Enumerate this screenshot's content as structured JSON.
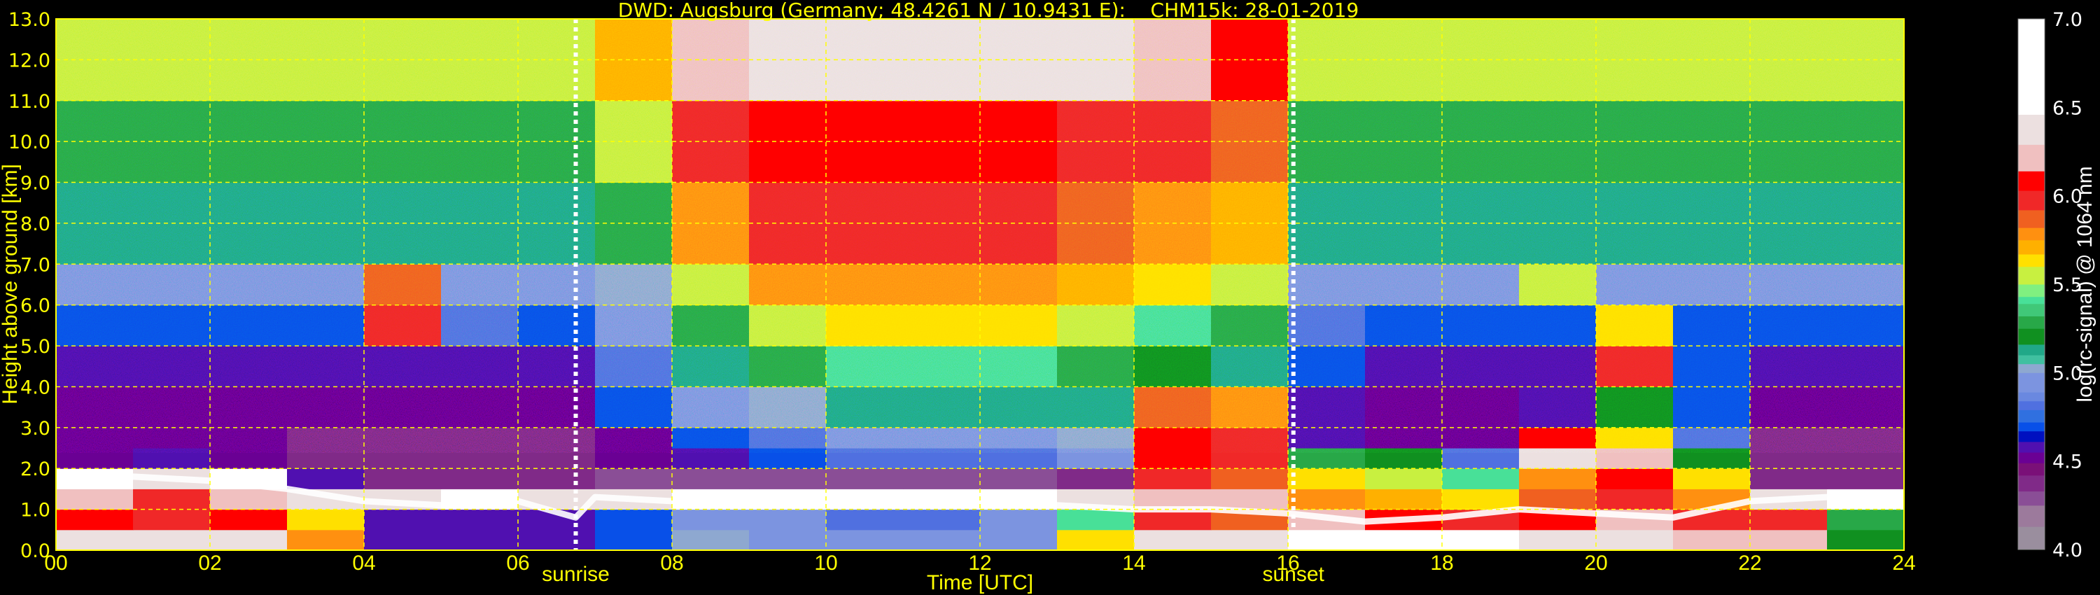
{
  "chart_data": {
    "type": "heatmap",
    "title": "DWD: Augsburg (Germany; 48.4261 N / 10.9431 E):    CHM15k: 28-01-2019",
    "xlabel": "Time [UTC]",
    "ylabel": "Height above ground [km]",
    "colorbar_label": "log(rc-signal) @ 1064 nm",
    "xlim": [
      0,
      24
    ],
    "ylim": [
      0,
      13
    ],
    "clim": [
      4.0,
      7.0
    ],
    "grid": true,
    "x_ticks": [
      "00",
      "02",
      "04",
      "06",
      "08",
      "10",
      "12",
      "14",
      "16",
      "18",
      "20",
      "22",
      "24"
    ],
    "y_ticks": [
      "0.0",
      "1.0",
      "2.0",
      "3.0",
      "4.0",
      "5.0",
      "6.0",
      "7.0",
      "8.0",
      "9.0",
      "10.0",
      "11.0",
      "12.0",
      "13.0"
    ],
    "colorbar_ticks": [
      "4.0",
      "4.5",
      "5.0",
      "5.5",
      "6.0",
      "6.5",
      "7.0"
    ],
    "annotations": [
      {
        "label": "sunrise",
        "time_h": 6.75
      },
      {
        "label": "sunset",
        "time_h": 16.07
      }
    ],
    "time_bins_h": [
      0,
      1,
      2,
      3,
      4,
      5,
      6,
      7,
      8,
      9,
      10,
      11,
      12,
      13,
      14,
      15,
      16,
      17,
      18,
      19,
      20,
      21,
      22,
      23,
      24
    ],
    "height_bins_km": [
      0,
      0.5,
      1,
      1.5,
      2,
      2.5,
      3,
      4,
      5,
      6,
      7,
      9,
      11,
      13
    ],
    "values": [
      [
        6.4,
        6.3,
        6.3,
        5.8,
        4.6,
        4.6,
        4.6,
        4.7,
        5.0,
        4.9,
        4.9,
        4.9,
        4.9,
        5.6,
        6.4,
        6.3,
        6.7,
        6.7,
        6.6,
        6.3,
        6.4,
        6.2,
        6.2,
        5.2
      ],
      [
        6.1,
        6.0,
        6.1,
        5.6,
        4.6,
        4.6,
        4.6,
        4.7,
        4.9,
        4.9,
        4.8,
        4.8,
        4.9,
        5.4,
        6.0,
        5.9,
        6.2,
        6.1,
        6.0,
        6.1,
        6.2,
        6.0,
        6.0,
        5.3
      ],
      [
        6.2,
        6.0,
        6.2,
        6.3,
        6.4,
        6.5,
        6.4,
        6.4,
        6.5,
        6.5,
        6.6,
        6.6,
        6.6,
        6.4,
        6.2,
        6.2,
        5.8,
        5.7,
        5.6,
        5.9,
        6.0,
        5.8,
        6.3,
        6.6
      ],
      [
        6.5,
        6.4,
        6.5,
        4.6,
        4.4,
        4.4,
        4.4,
        4.3,
        4.3,
        4.3,
        4.3,
        4.3,
        4.3,
        4.4,
        6.0,
        5.9,
        5.6,
        5.5,
        5.4,
        5.8,
        6.1,
        5.6,
        4.4,
        4.4
      ],
      [
        4.5,
        4.6,
        4.5,
        4.4,
        4.4,
        4.4,
        4.4,
        4.5,
        4.6,
        4.7,
        4.8,
        4.8,
        4.8,
        4.9,
        6.1,
        6.0,
        5.3,
        5.2,
        4.8,
        6.3,
        6.2,
        5.2,
        4.4,
        4.4
      ],
      [
        4.5,
        4.5,
        4.5,
        4.4,
        4.4,
        4.4,
        4.4,
        4.5,
        4.7,
        4.8,
        4.9,
        4.9,
        4.9,
        5.0,
        6.1,
        6.0,
        4.6,
        4.5,
        4.5,
        6.1,
        5.6,
        4.8,
        4.4,
        4.4
      ],
      [
        4.5,
        4.5,
        4.5,
        4.5,
        4.5,
        4.5,
        4.5,
        4.7,
        4.9,
        5.0,
        5.1,
        5.1,
        5.1,
        5.1,
        5.9,
        5.8,
        4.6,
        4.5,
        4.5,
        4.6,
        5.2,
        4.7,
        4.5,
        4.5
      ],
      [
        4.6,
        4.6,
        4.6,
        4.6,
        4.6,
        4.6,
        4.6,
        4.8,
        5.1,
        5.3,
        5.4,
        5.4,
        5.4,
        5.3,
        5.2,
        5.1,
        4.7,
        4.6,
        4.6,
        4.6,
        6.0,
        4.7,
        4.6,
        4.6
      ],
      [
        4.7,
        4.7,
        4.7,
        4.7,
        6.0,
        4.8,
        4.7,
        4.9,
        5.3,
        5.5,
        5.6,
        5.6,
        5.6,
        5.5,
        5.4,
        5.3,
        4.8,
        4.7,
        4.7,
        4.7,
        5.6,
        4.7,
        4.7,
        4.7
      ],
      [
        4.9,
        4.9,
        4.9,
        4.9,
        5.9,
        4.9,
        4.9,
        5.0,
        5.5,
        5.8,
        5.8,
        5.8,
        5.8,
        5.7,
        5.6,
        5.5,
        4.9,
        4.9,
        4.9,
        5.5,
        4.9,
        4.9,
        4.9,
        4.9
      ],
      [
        5.1,
        5.1,
        5.1,
        5.1,
        5.1,
        5.1,
        5.1,
        5.3,
        5.8,
        6.0,
        6.0,
        6.0,
        6.0,
        5.9,
        5.8,
        5.7,
        5.1,
        5.1,
        5.1,
        5.1,
        5.1,
        5.1,
        5.1,
        5.1
      ],
      [
        5.3,
        5.3,
        5.3,
        5.3,
        5.3,
        5.3,
        5.3,
        5.5,
        6.0,
        6.1,
        6.1,
        6.1,
        6.1,
        6.0,
        6.0,
        5.9,
        5.3,
        5.3,
        5.3,
        5.3,
        5.3,
        5.3,
        5.3,
        5.3
      ],
      [
        5.5,
        5.5,
        5.5,
        5.5,
        5.5,
        5.5,
        5.5,
        5.7,
        6.2,
        6.3,
        6.4,
        6.4,
        6.4,
        6.3,
        6.2,
        6.1,
        5.5,
        5.5,
        5.5,
        5.5,
        5.5,
        5.5,
        5.5,
        5.5
      ]
    ],
    "boundary_layer_top": {
      "time_h": [
        0,
        1,
        2,
        3,
        4,
        5,
        6,
        6.75,
        7,
        8,
        9,
        10,
        11,
        12,
        13,
        14,
        15,
        16,
        17,
        18,
        19,
        20,
        21,
        22,
        23,
        24
      ],
      "height_km": [
        1.7,
        1.8,
        1.7,
        1.5,
        1.2,
        1.1,
        1.2,
        0.8,
        1.3,
        1.2,
        1.2,
        1.1,
        1.2,
        1.2,
        1.1,
        1.0,
        1.0,
        0.9,
        0.7,
        0.8,
        1.0,
        0.9,
        0.8,
        1.2,
        1.3,
        1.4
      ]
    },
    "colormap": [
      {
        "min": 4.0,
        "color": "#9a8e9e"
      },
      {
        "min": 4.13,
        "color": "#9c7a9c"
      },
      {
        "min": 4.25,
        "color": "#8a4e96"
      },
      {
        "min": 4.33,
        "color": "#802a88"
      },
      {
        "min": 4.42,
        "color": "#7a1078"
      },
      {
        "min": 4.49,
        "color": "#6a0094"
      },
      {
        "min": 4.55,
        "color": "#5010b0"
      },
      {
        "min": 4.61,
        "color": "#0010c0"
      },
      {
        "min": 4.67,
        "color": "#0850e8"
      },
      {
        "min": 4.72,
        "color": "#3070e0"
      },
      {
        "min": 4.79,
        "color": "#5070e0"
      },
      {
        "min": 4.84,
        "color": "#6a88e0"
      },
      {
        "min": 4.89,
        "color": "#7c94e0"
      },
      {
        "min": 5.0,
        "color": "#8ea8d0"
      },
      {
        "min": 5.05,
        "color": "#40c0a0"
      },
      {
        "min": 5.1,
        "color": "#20a888"
      },
      {
        "min": 5.16,
        "color": "#109020"
      },
      {
        "min": 5.25,
        "color": "#28a848"
      },
      {
        "min": 5.32,
        "color": "#40c878"
      },
      {
        "min": 5.39,
        "color": "#48e098"
      },
      {
        "min": 5.43,
        "color": "#80f080"
      },
      {
        "min": 5.5,
        "color": "#c8f040"
      },
      {
        "min": 5.6,
        "color": "#ffe000"
      },
      {
        "min": 5.67,
        "color": "#ffb000"
      },
      {
        "min": 5.75,
        "color": "#ff9010"
      },
      {
        "min": 5.82,
        "color": "#f06020"
      },
      {
        "min": 5.92,
        "color": "#f02828"
      },
      {
        "min": 6.03,
        "color": "#ff0000"
      },
      {
        "min": 6.14,
        "color": "#f0c0c0"
      },
      {
        "min": 6.29,
        "color": "#ece0e0"
      },
      {
        "min": 6.46,
        "color": "#ffffff"
      }
    ],
    "colors": {
      "text": "#ffff00",
      "grid": "#ffff00",
      "background": "#000000",
      "markers": "#ffffff"
    }
  }
}
